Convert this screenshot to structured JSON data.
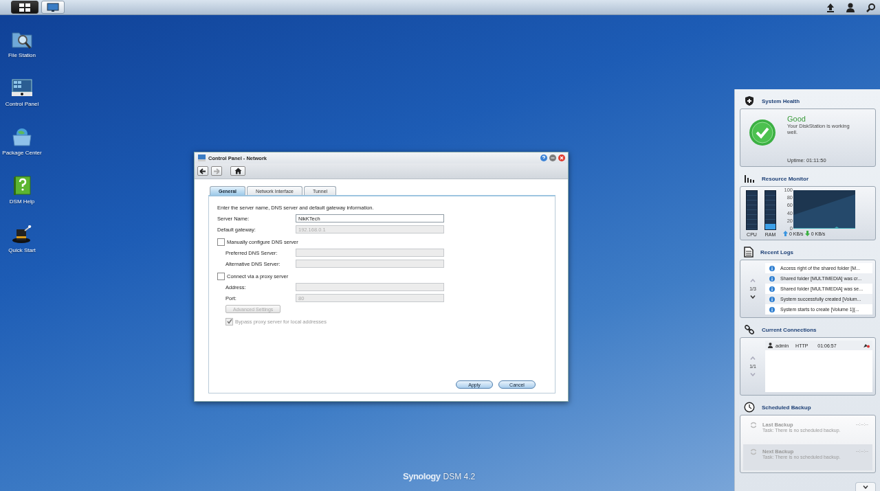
{
  "taskbar": {
    "buttons": [
      {
        "kind": "menu",
        "selected": false
      },
      {
        "kind": "desktop",
        "selected": true
      }
    ]
  },
  "desktop_icons": [
    {
      "kind": "folder",
      "label": "File Station"
    },
    {
      "kind": "panel",
      "label": "Control Panel"
    },
    {
      "kind": "package",
      "label": "Package Center"
    },
    {
      "kind": "help",
      "label": "DSM Help"
    },
    {
      "kind": "hat",
      "label": "Quick Start"
    }
  ],
  "window": {
    "title": "Control Panel - Network",
    "nav": [
      {
        "kind": "back",
        "disabled": false
      },
      {
        "kind": "forward",
        "disabled": true
      },
      {
        "kind": "home",
        "disabled": false
      }
    ],
    "tabs": [
      {
        "label": "General",
        "selected": true
      },
      {
        "label": "Network Interface",
        "selected": false
      },
      {
        "label": "Tunnel",
        "selected": false
      }
    ],
    "intro": "Enter the server name, DNS server and default gateway information.",
    "form": [
      {
        "kind": "field",
        "label": "Server Name:",
        "value": "NikKTech",
        "disabled": false
      },
      {
        "kind": "field",
        "label": "Default gateway:",
        "value": "192.168.0.1",
        "disabled": true
      },
      {
        "kind": "checkbox",
        "label": "Manually configure DNS server",
        "checked": false,
        "disabled": false,
        "children": [
          {
            "kind": "field",
            "label": "Preferred DNS Server:",
            "disabled": true
          },
          {
            "kind": "field",
            "label": "Alternative DNS Server:",
            "disabled": true
          }
        ]
      },
      {
        "kind": "checkbox",
        "label": "Connect via a proxy server",
        "checked": false,
        "disabled": false,
        "children": [
          {
            "kind": "field",
            "label": "Address:",
            "disabled": true
          },
          {
            "kind": "field",
            "label": "Port:",
            "value": "80",
            "disabled": true
          },
          {
            "kind": "button",
            "label": "Advanced Settings",
            "disabled": true
          },
          {
            "kind": "checkbox",
            "label": "Bypass proxy server for local addresses",
            "checked": true,
            "disabled": true
          }
        ]
      }
    ],
    "buttons": [
      "Apply",
      "Cancel"
    ]
  },
  "widgets": {
    "system_health": {
      "title": "System Health",
      "status": "Good",
      "message": "Your DiskStation is working well.",
      "uptime": "Uptime: 01:11:50"
    },
    "resource_monitor": {
      "title": "Resource Monitor",
      "meters": [
        {
          "name": "CPU",
          "level": 0.0
        },
        {
          "name": "RAM",
          "level": 0.15
        }
      ],
      "graph_axis": [
        "100",
        "80",
        "60",
        "40",
        "20",
        "0"
      ],
      "upload": "0 KB/s",
      "download": "0 KB/s"
    },
    "recent_logs": {
      "title": "Recent Logs",
      "page": "1/3",
      "up_disabled": true,
      "down_disabled": false,
      "items": [
        "Access right of the shared folder [M...",
        "Shared folder [MULTIMEDIA] was cr...",
        "Shared folder [MULTIMEDIA] was se...",
        "System successfully created [Volum...",
        "System starts to create [Volume 1](..."
      ]
    },
    "current_connections": {
      "title": "Current Connections",
      "page": "1/1",
      "up_disabled": true,
      "down_disabled": true,
      "rows": [
        {
          "user": "admin",
          "protocol": "HTTP",
          "time": "01:06:57"
        }
      ]
    },
    "scheduled_backup": {
      "title": "Scheduled Backup",
      "items": [
        {
          "title": "Last Backup",
          "task": "Task: There is no scheduled backup.",
          "time": "--:--:--"
        },
        {
          "title": "Next Backup",
          "task": "Task: There is no scheduled backup.",
          "time": "--:--:--"
        }
      ]
    }
  },
  "brand": {
    "name": "Synology",
    "version": "DSM 4.2"
  }
}
